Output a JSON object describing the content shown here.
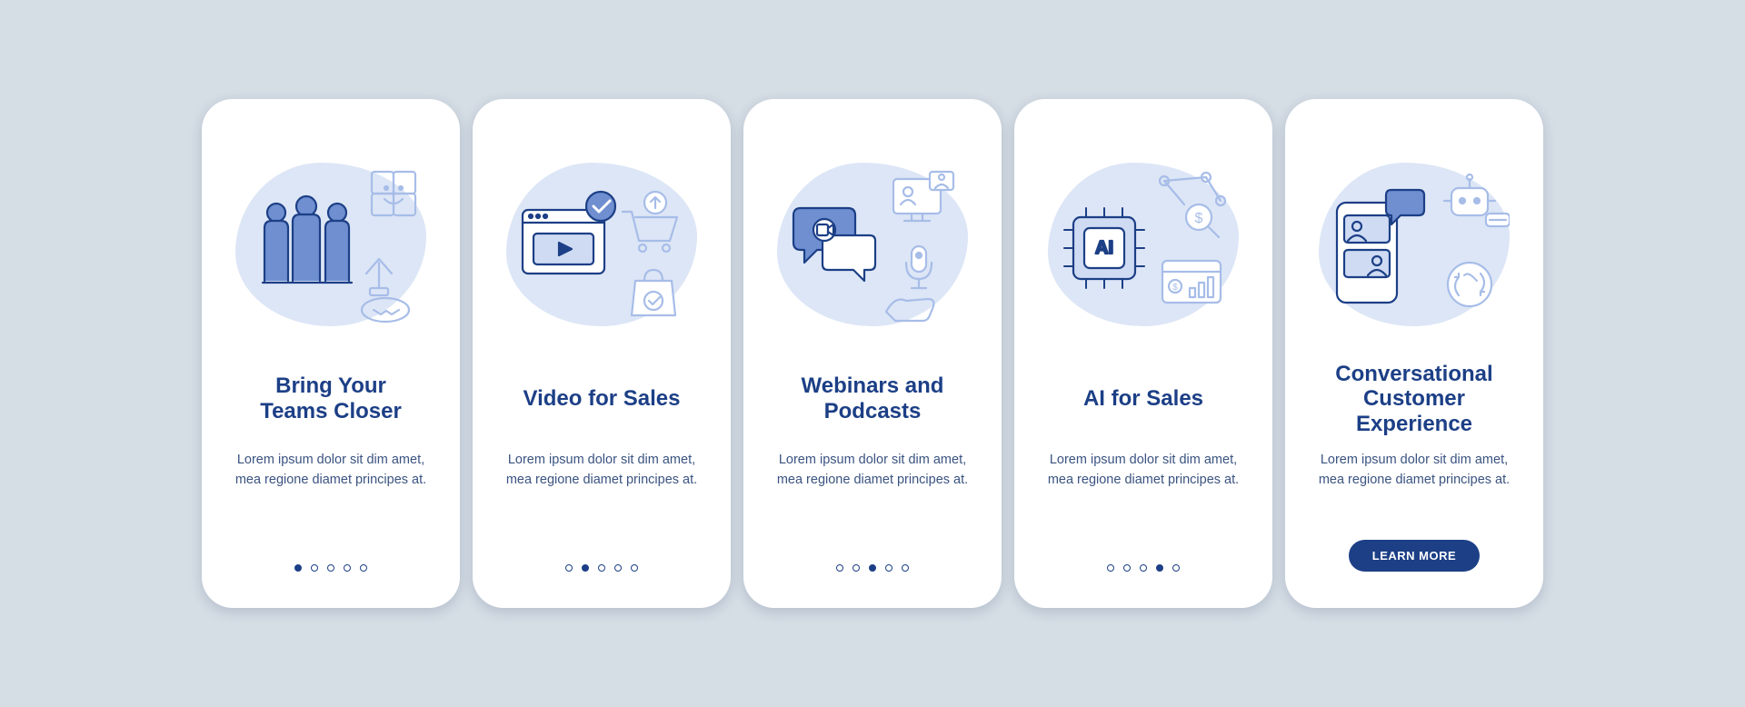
{
  "screens": [
    {
      "title": "Bring Your\nTeams Closer",
      "description": "Lorem ipsum dolor sit dim amet, mea regione diamet principes at.",
      "active_dot": 0,
      "icon": "teams-together-icon"
    },
    {
      "title": "Video for Sales",
      "description": "Lorem ipsum dolor sit dim amet, mea regione diamet principes at.",
      "active_dot": 1,
      "icon": "video-sales-icon"
    },
    {
      "title": "Webinars and\nPodcasts",
      "description": "Lorem ipsum dolor sit dim amet, mea regione diamet principes at.",
      "active_dot": 2,
      "icon": "webinars-podcasts-icon"
    },
    {
      "title": "AI for Sales",
      "description": "Lorem ipsum dolor sit dim amet, mea regione diamet principes at.",
      "active_dot": 3,
      "icon": "ai-sales-icon"
    },
    {
      "title": "Conversational\nCustomer\nExperience",
      "description": "Lorem ipsum dolor sit dim amet, mea regione diamet principes at.",
      "active_dot": 4,
      "icon": "conversational-cx-icon",
      "cta_label": "LEARN MORE"
    }
  ],
  "total_dots": 5,
  "colors": {
    "brand": "#1c3f86",
    "blob": "#dde6f6",
    "bg": "#d5dde5",
    "card": "#ffffff",
    "stroke_light": "#a7bde8",
    "fill_mid": "#6f8fd0"
  }
}
